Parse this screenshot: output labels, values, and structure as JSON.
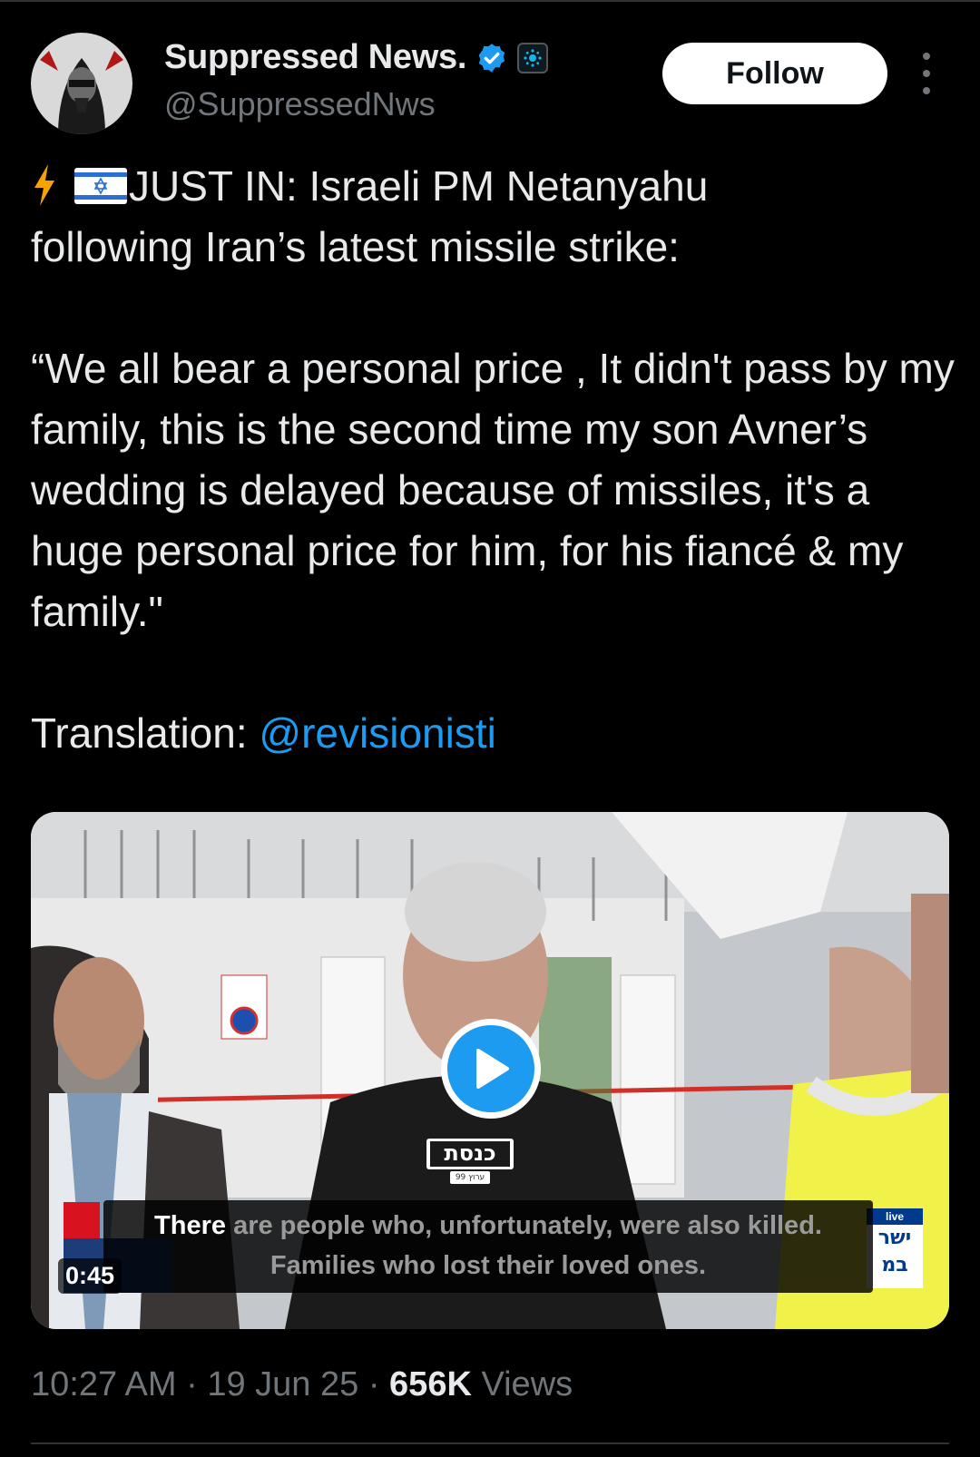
{
  "author": {
    "name": "Suppressed News.",
    "handle": "@SuppressedNws",
    "verified": true,
    "avatar_icon": "masked-figure-avatar"
  },
  "follow_label": "Follow",
  "tweet": {
    "line1": "JUST IN: Israeli PM Netanyahu",
    "line2": "following Iran’s latest missile strike:",
    "quote": "“We all bear a personal price , It didn't pass by my family, this is the second time my son Avner’s wedding is delayed because of missiles, it's a huge personal price for him, for his fiancé & my family.\"",
    "translation_label": "Translation: ",
    "translation_mention": "@revisionisti"
  },
  "video": {
    "caption_highlight": "There",
    "caption_rest": " are people who, unfortunately, were also killed.",
    "caption_line2": "Families who lost their loved ones.",
    "duration": "0:45",
    "channel_logo_text": "כנסת",
    "channel_sub_text": "ערוץ 99",
    "side_logo_top": "live",
    "side_logo_text": "ישר במ"
  },
  "meta": {
    "time": "10:27 AM",
    "date": "19 Jun 25",
    "views_count": "656K",
    "views_label": "Views",
    "separator": " · "
  },
  "colors": {
    "background": "#000000",
    "accent": "#1d9bf0",
    "muted": "#71767b",
    "text": "#e7e9ea"
  }
}
